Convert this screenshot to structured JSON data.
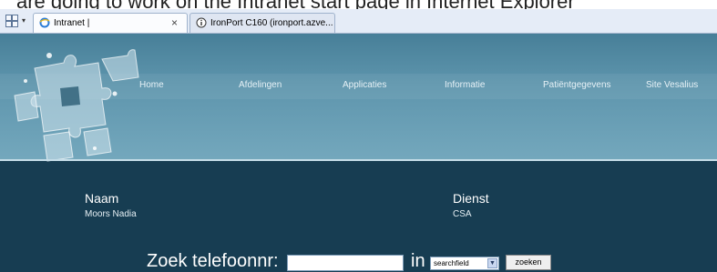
{
  "caption": {
    "text": "are going to work on the Intranet start page in Internet Explorer"
  },
  "browser": {
    "tab_list_dropdown": "▾",
    "tabs": [
      {
        "label": "Intranet |",
        "close": "×"
      },
      {
        "label": "IronPort C160 (ironport.azve..."
      }
    ]
  },
  "nav": {
    "items": [
      "Home",
      "Afdelingen",
      "Applicaties",
      "Informatie",
      "Patiëntgegevens",
      "Site Vesalius"
    ]
  },
  "profile": {
    "name_label": "Naam",
    "name_value": "Moors Nadia",
    "dept_label": "Dienst",
    "dept_value": "CSA"
  },
  "search": {
    "label": "Zoek telefoonnr:",
    "input_value": "",
    "in_label": "in",
    "select_value": "searchfield",
    "button_label": "zoeken"
  },
  "colors": {
    "page_bg": "#173d52",
    "header_top": "#477f98",
    "header_bottom": "#74a8bd"
  }
}
